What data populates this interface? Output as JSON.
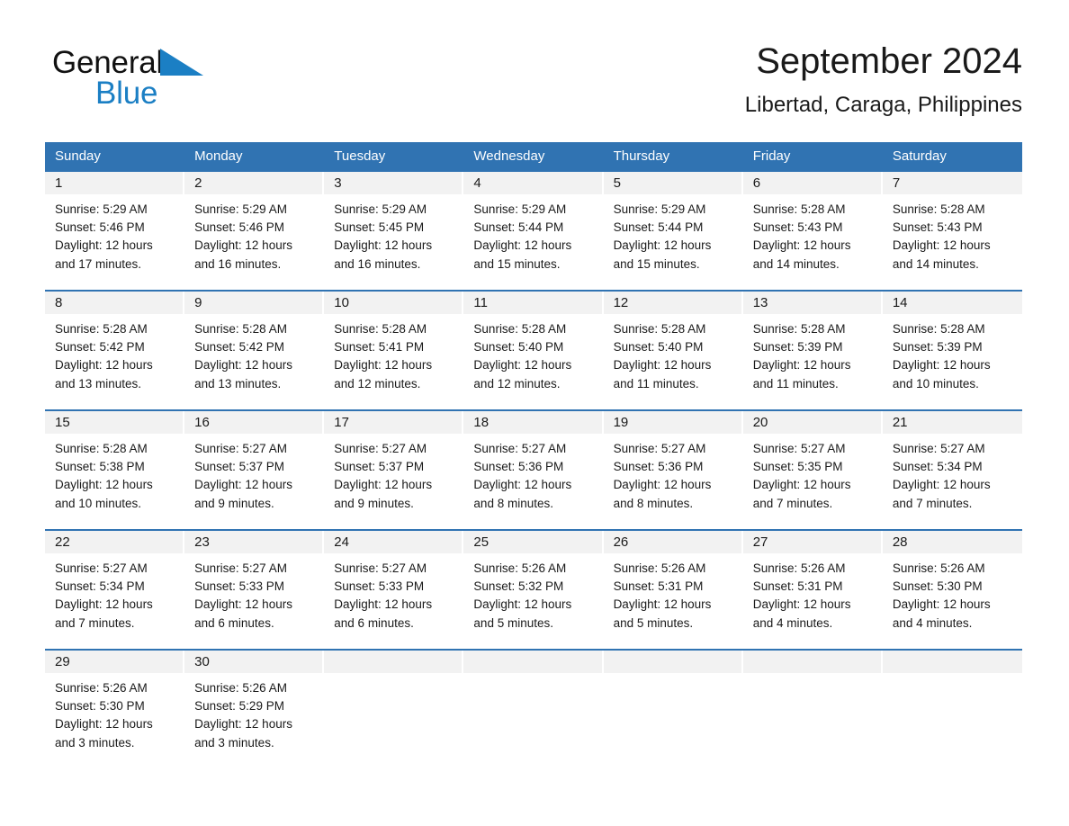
{
  "brand": {
    "name_part1": "General",
    "name_part2": "Blue",
    "triangle_icon": "brand-triangle-icon",
    "accent_color": "#1b7fc4"
  },
  "header": {
    "title": "September 2024",
    "subtitle": "Libertad, Caraga, Philippines"
  },
  "theme": {
    "header_blue": "#3073b2",
    "band_gray": "#f2f2f2",
    "text": "#1a1a1a"
  },
  "weekdays": [
    "Sunday",
    "Monday",
    "Tuesday",
    "Wednesday",
    "Thursday",
    "Friday",
    "Saturday"
  ],
  "weeks": [
    [
      {
        "day": "1",
        "sunrise": "Sunrise: 5:29 AM",
        "sunset": "Sunset: 5:46 PM",
        "daylight1": "Daylight: 12 hours",
        "daylight2": "and 17 minutes."
      },
      {
        "day": "2",
        "sunrise": "Sunrise: 5:29 AM",
        "sunset": "Sunset: 5:46 PM",
        "daylight1": "Daylight: 12 hours",
        "daylight2": "and 16 minutes."
      },
      {
        "day": "3",
        "sunrise": "Sunrise: 5:29 AM",
        "sunset": "Sunset: 5:45 PM",
        "daylight1": "Daylight: 12 hours",
        "daylight2": "and 16 minutes."
      },
      {
        "day": "4",
        "sunrise": "Sunrise: 5:29 AM",
        "sunset": "Sunset: 5:44 PM",
        "daylight1": "Daylight: 12 hours",
        "daylight2": "and 15 minutes."
      },
      {
        "day": "5",
        "sunrise": "Sunrise: 5:29 AM",
        "sunset": "Sunset: 5:44 PM",
        "daylight1": "Daylight: 12 hours",
        "daylight2": "and 15 minutes."
      },
      {
        "day": "6",
        "sunrise": "Sunrise: 5:28 AM",
        "sunset": "Sunset: 5:43 PM",
        "daylight1": "Daylight: 12 hours",
        "daylight2": "and 14 minutes."
      },
      {
        "day": "7",
        "sunrise": "Sunrise: 5:28 AM",
        "sunset": "Sunset: 5:43 PM",
        "daylight1": "Daylight: 12 hours",
        "daylight2": "and 14 minutes."
      }
    ],
    [
      {
        "day": "8",
        "sunrise": "Sunrise: 5:28 AM",
        "sunset": "Sunset: 5:42 PM",
        "daylight1": "Daylight: 12 hours",
        "daylight2": "and 13 minutes."
      },
      {
        "day": "9",
        "sunrise": "Sunrise: 5:28 AM",
        "sunset": "Sunset: 5:42 PM",
        "daylight1": "Daylight: 12 hours",
        "daylight2": "and 13 minutes."
      },
      {
        "day": "10",
        "sunrise": "Sunrise: 5:28 AM",
        "sunset": "Sunset: 5:41 PM",
        "daylight1": "Daylight: 12 hours",
        "daylight2": "and 12 minutes."
      },
      {
        "day": "11",
        "sunrise": "Sunrise: 5:28 AM",
        "sunset": "Sunset: 5:40 PM",
        "daylight1": "Daylight: 12 hours",
        "daylight2": "and 12 minutes."
      },
      {
        "day": "12",
        "sunrise": "Sunrise: 5:28 AM",
        "sunset": "Sunset: 5:40 PM",
        "daylight1": "Daylight: 12 hours",
        "daylight2": "and 11 minutes."
      },
      {
        "day": "13",
        "sunrise": "Sunrise: 5:28 AM",
        "sunset": "Sunset: 5:39 PM",
        "daylight1": "Daylight: 12 hours",
        "daylight2": "and 11 minutes."
      },
      {
        "day": "14",
        "sunrise": "Sunrise: 5:28 AM",
        "sunset": "Sunset: 5:39 PM",
        "daylight1": "Daylight: 12 hours",
        "daylight2": "and 10 minutes."
      }
    ],
    [
      {
        "day": "15",
        "sunrise": "Sunrise: 5:28 AM",
        "sunset": "Sunset: 5:38 PM",
        "daylight1": "Daylight: 12 hours",
        "daylight2": "and 10 minutes."
      },
      {
        "day": "16",
        "sunrise": "Sunrise: 5:27 AM",
        "sunset": "Sunset: 5:37 PM",
        "daylight1": "Daylight: 12 hours",
        "daylight2": "and 9 minutes."
      },
      {
        "day": "17",
        "sunrise": "Sunrise: 5:27 AM",
        "sunset": "Sunset: 5:37 PM",
        "daylight1": "Daylight: 12 hours",
        "daylight2": "and 9 minutes."
      },
      {
        "day": "18",
        "sunrise": "Sunrise: 5:27 AM",
        "sunset": "Sunset: 5:36 PM",
        "daylight1": "Daylight: 12 hours",
        "daylight2": "and 8 minutes."
      },
      {
        "day": "19",
        "sunrise": "Sunrise: 5:27 AM",
        "sunset": "Sunset: 5:36 PM",
        "daylight1": "Daylight: 12 hours",
        "daylight2": "and 8 minutes."
      },
      {
        "day": "20",
        "sunrise": "Sunrise: 5:27 AM",
        "sunset": "Sunset: 5:35 PM",
        "daylight1": "Daylight: 12 hours",
        "daylight2": "and 7 minutes."
      },
      {
        "day": "21",
        "sunrise": "Sunrise: 5:27 AM",
        "sunset": "Sunset: 5:34 PM",
        "daylight1": "Daylight: 12 hours",
        "daylight2": "and 7 minutes."
      }
    ],
    [
      {
        "day": "22",
        "sunrise": "Sunrise: 5:27 AM",
        "sunset": "Sunset: 5:34 PM",
        "daylight1": "Daylight: 12 hours",
        "daylight2": "and 7 minutes."
      },
      {
        "day": "23",
        "sunrise": "Sunrise: 5:27 AM",
        "sunset": "Sunset: 5:33 PM",
        "daylight1": "Daylight: 12 hours",
        "daylight2": "and 6 minutes."
      },
      {
        "day": "24",
        "sunrise": "Sunrise: 5:27 AM",
        "sunset": "Sunset: 5:33 PM",
        "daylight1": "Daylight: 12 hours",
        "daylight2": "and 6 minutes."
      },
      {
        "day": "25",
        "sunrise": "Sunrise: 5:26 AM",
        "sunset": "Sunset: 5:32 PM",
        "daylight1": "Daylight: 12 hours",
        "daylight2": "and 5 minutes."
      },
      {
        "day": "26",
        "sunrise": "Sunrise: 5:26 AM",
        "sunset": "Sunset: 5:31 PM",
        "daylight1": "Daylight: 12 hours",
        "daylight2": "and 5 minutes."
      },
      {
        "day": "27",
        "sunrise": "Sunrise: 5:26 AM",
        "sunset": "Sunset: 5:31 PM",
        "daylight1": "Daylight: 12 hours",
        "daylight2": "and 4 minutes."
      },
      {
        "day": "28",
        "sunrise": "Sunrise: 5:26 AM",
        "sunset": "Sunset: 5:30 PM",
        "daylight1": "Daylight: 12 hours",
        "daylight2": "and 4 minutes."
      }
    ],
    [
      {
        "day": "29",
        "sunrise": "Sunrise: 5:26 AM",
        "sunset": "Sunset: 5:30 PM",
        "daylight1": "Daylight: 12 hours",
        "daylight2": "and 3 minutes."
      },
      {
        "day": "30",
        "sunrise": "Sunrise: 5:26 AM",
        "sunset": "Sunset: 5:29 PM",
        "daylight1": "Daylight: 12 hours",
        "daylight2": "and 3 minutes."
      },
      {
        "day": "",
        "sunrise": "",
        "sunset": "",
        "daylight1": "",
        "daylight2": ""
      },
      {
        "day": "",
        "sunrise": "",
        "sunset": "",
        "daylight1": "",
        "daylight2": ""
      },
      {
        "day": "",
        "sunrise": "",
        "sunset": "",
        "daylight1": "",
        "daylight2": ""
      },
      {
        "day": "",
        "sunrise": "",
        "sunset": "",
        "daylight1": "",
        "daylight2": ""
      },
      {
        "day": "",
        "sunrise": "",
        "sunset": "",
        "daylight1": "",
        "daylight2": ""
      }
    ]
  ]
}
